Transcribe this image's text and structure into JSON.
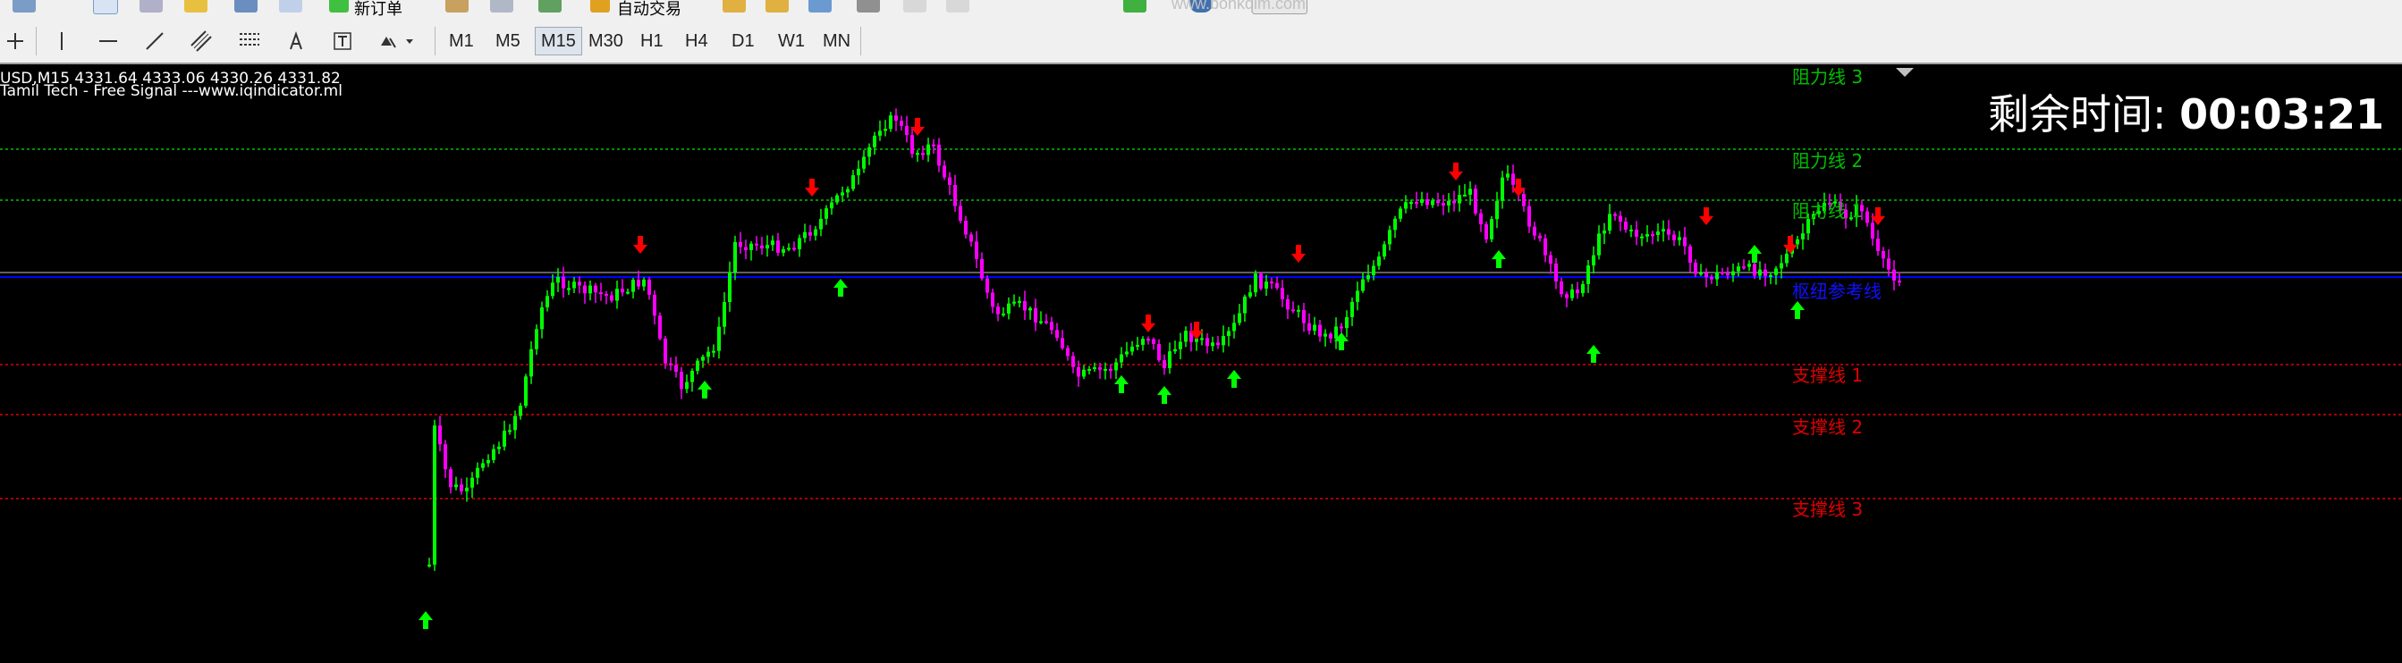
{
  "toolbar": {
    "new_order_label": "新订单",
    "autotrade_label": "自动交易",
    "watermark": "www.bonkqim.com",
    "timeframes": [
      "M1",
      "M5",
      "M15",
      "M30",
      "H1",
      "H4",
      "D1",
      "W1",
      "MN"
    ],
    "active_timeframe": "M15"
  },
  "chart": {
    "info_line": "USD,M15  4331.64 4333.06 4330.26 4331.82",
    "signal_line": "Tamil Tech - Free Signal ---www.iqindicator.ml",
    "timer_label": "剩余时间: ",
    "timer_value": "00:03:21",
    "levels": {
      "resistance_3": "阻力线 3",
      "resistance_2": "阻力线 2",
      "resistance_1": "阻力线 1",
      "pivot": "枢纽参考线",
      "support_1": "支撑线 1",
      "support_2": "支撑线 2",
      "support_3": "支撑线 3"
    },
    "colors": {
      "bull": "#00ff00",
      "bear": "#ff00ff",
      "resistance": "#00c000",
      "support": "#e00000",
      "pivot": "#0000ff",
      "price_line": "#c0c0c0",
      "up_arrow": "#00ff00",
      "down_arrow": "#ff0000"
    }
  }
}
